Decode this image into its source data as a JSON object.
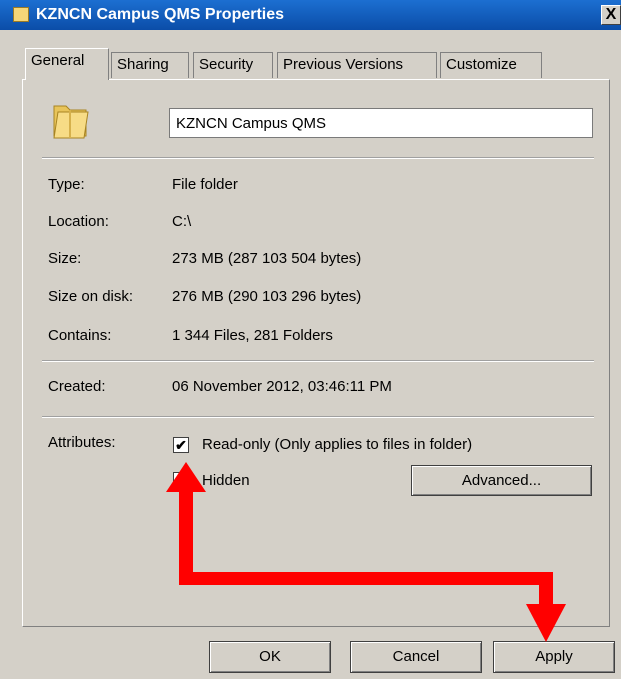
{
  "window": {
    "title": "KZNCN Campus QMS Properties",
    "close_glyph": "X",
    "icon": "folder-icon"
  },
  "tabs": [
    {
      "label": "General"
    },
    {
      "label": "Sharing"
    },
    {
      "label": "Security"
    },
    {
      "label": "Previous Versions"
    },
    {
      "label": "Customize"
    }
  ],
  "general": {
    "folder_name": "KZNCN Campus QMS",
    "props": {
      "type_label": "Type:",
      "type_value": "File folder",
      "location_label": "Location:",
      "location_value": "C:\\",
      "size_label": "Size:",
      "size_value": "273 MB (287 103 504 bytes)",
      "size_on_disk_label": "Size on disk:",
      "size_on_disk_value": "276 MB (290 103 296 bytes)",
      "contains_label": "Contains:",
      "contains_value": "1 344 Files, 281 Folders",
      "created_label": "Created:",
      "created_value": "06 November 2012, 03:46:11 PM",
      "attributes_label": "Attributes:"
    },
    "attributes": {
      "readonly_label": "Read-only (Only applies to files in folder)",
      "readonly_checked": true,
      "readonly_mark": "✔",
      "hidden_label": "Hidden",
      "hidden_checked": false,
      "advanced_label": "Advanced..."
    }
  },
  "buttons": {
    "ok": "OK",
    "cancel": "Cancel",
    "apply": "Apply"
  },
  "annotation": {
    "color": "#ff0000"
  }
}
